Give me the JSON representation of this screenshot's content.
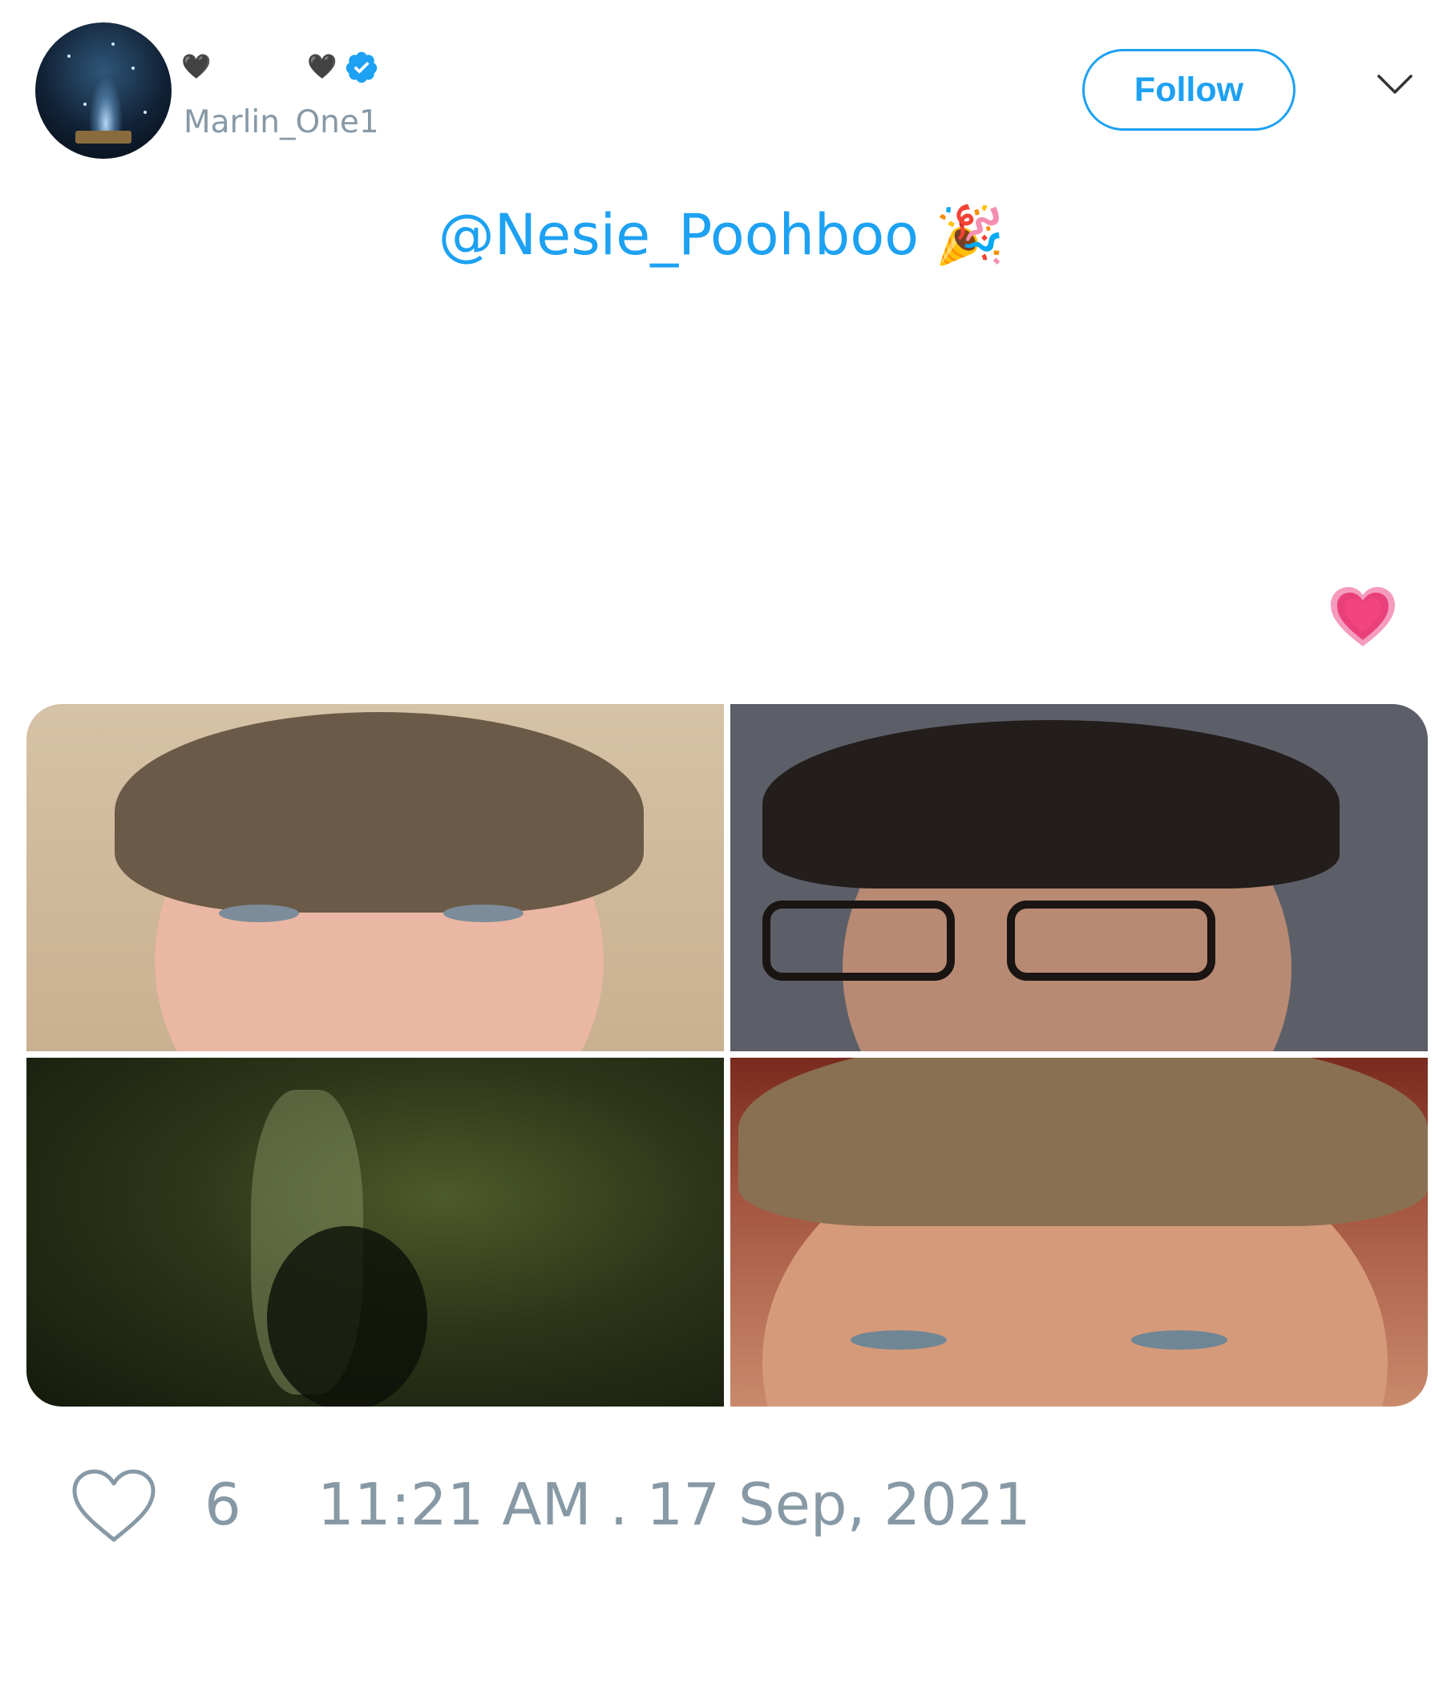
{
  "tweet": {
    "author": {
      "display_name_left": "🖤",
      "display_name_right": "🖤",
      "handle": "Marlin_One1",
      "verified": true
    },
    "follow_label": "Follow",
    "mention": "@Nesie_Poohboo",
    "mention_emoji": "🎉",
    "trailing_emoji": "💗",
    "media_count": 4,
    "like_count": "6",
    "timestamp": "11:21 AM . 17 Sep, 2021"
  },
  "colors": {
    "accent": "#1da1f2",
    "muted": "#8899a6",
    "verified_badge": "#1da1f2",
    "heart_pink": "#f2447e"
  },
  "icons": {
    "verified": "verified-badge-icon",
    "chevron": "chevron-down-icon",
    "like": "heart-outline-icon"
  }
}
